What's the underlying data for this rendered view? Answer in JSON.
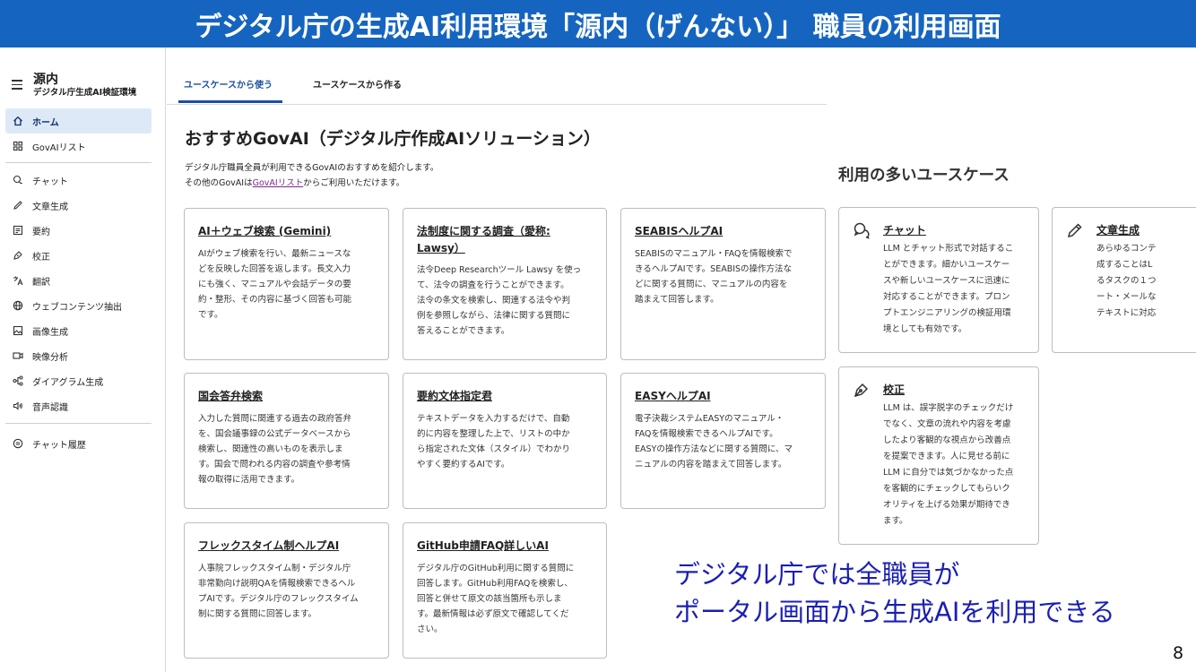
{
  "banner": {
    "title": "デジタル庁の生成AI利用環境「源内（げんない）」 職員の利用画面"
  },
  "sidebar": {
    "brand": "源内",
    "brand_sub": "デジタル庁生成AI検証環境",
    "items": [
      {
        "label": "ホーム",
        "icon": "home-icon"
      },
      {
        "label": "GovAIリスト",
        "icon": "grid-icon"
      },
      {
        "label": "チャット",
        "icon": "chat-icon"
      },
      {
        "label": "文章生成",
        "icon": "pencil-icon"
      },
      {
        "label": "要約",
        "icon": "summary-icon"
      },
      {
        "label": "校正",
        "icon": "pen-icon"
      },
      {
        "label": "翻訳",
        "icon": "translate-icon"
      },
      {
        "label": "ウェブコンテンツ抽出",
        "icon": "globe-icon"
      },
      {
        "label": "画像生成",
        "icon": "image-icon"
      },
      {
        "label": "映像分析",
        "icon": "video-icon"
      },
      {
        "label": "ダイアグラム生成",
        "icon": "diagram-icon"
      },
      {
        "label": "音声認識",
        "icon": "speaker-icon"
      },
      {
        "label": "チャット履歴",
        "icon": "history-icon"
      }
    ]
  },
  "tabs": [
    "ユースケースから使う",
    "ユースケースから作る"
  ],
  "main": {
    "heading": "おすすめGovAI（デジタル庁作成AIソリューション）",
    "intro_line1": "デジタル庁職員全員が利用できるGovAIのおすすめを紹介します。",
    "intro_line2_pre": "その他のGovAIは",
    "intro_link": "GovAIリスト",
    "intro_line2_post": "からご利用いただけます。"
  },
  "cards": [
    {
      "title": "AI＋ウェブ検索 (Gemini)",
      "lines": [
        "AIがウェブ検索を行い、最新ニュースな",
        "どを反映した回答を返します。長文入力",
        "にも強く、マニュアルや会話データの要",
        "約・整形、その内容に基づく回答も可能",
        "です。"
      ]
    },
    {
      "title": "法制度に関する調査（愛称:",
      "title2": "Lawsy）",
      "lines": [
        "法令Deep Researchツール Lawsy を使っ",
        "て、法令の調査を行うことができます。",
        "法令の条文を検索し、関連する法令や判",
        "例を参照しながら、法律に関する質問に",
        "答えることができます。"
      ]
    },
    {
      "title": "SEABISヘルプAI",
      "lines": [
        "SEABISのマニュアル・FAQを情報検索で",
        "きるヘルプAIです。SEABISの操作方法な",
        "どに関する質問に、マニュアルの内容を",
        "踏まえて回答します。"
      ]
    },
    {
      "title": "国会答弁検索",
      "lines": [
        "入力した質問に関連する過去の政府答弁",
        "を、国会議事録の公式データベースから",
        "検索し、関連性の高いものを表示しま",
        "す。国会で問われる内容の調査や参考情",
        "報の取得に活用できます。"
      ]
    },
    {
      "title": "要約文体指定君",
      "lines": [
        "テキストデータを入力するだけで、自動",
        "的に内容を整理した上で、リストの中か",
        "ら指定された文体（スタイル）でわかり",
        "やすく要約するAIです。"
      ]
    },
    {
      "title": "EASYヘルプAI",
      "lines": [
        "電子決裁システムEASYのマニュアル・",
        "FAQを情報検索できるヘルプAIです。",
        "EASYの操作方法などに関する質問に、マ",
        "ニュアルの内容を踏まえて回答します。"
      ]
    },
    {
      "title": "フレックスタイム制ヘルプAI",
      "lines": [
        "人事院フレックスタイム制・デジタル庁",
        "非常勤向け説明QAを情報検索できるヘル",
        "プAIです。デジタル庁のフレックスタイム",
        "制に関する質問に回答します。"
      ]
    },
    {
      "title": "GitHub申請FAQ詳しいAI",
      "lines": [
        "デジタル庁のGitHub利用に関する質問に",
        "回答します。GitHub利用FAQを検索し、",
        "回答と併せて原文の該当箇所も示しま",
        "す。最新情報は必ず原文で確認してくだ",
        "さい。"
      ]
    }
  ],
  "usecases": {
    "heading": "利用の多いユースケース",
    "items": [
      {
        "title": "チャット",
        "icon": "chat-icon",
        "lines": [
          "LLM とチャット形式で対話するこ",
          "とができます。細かいユースケー",
          "スや新しいユースケースに迅速に",
          "対応することができます。プロン",
          "プトエンジニアリングの検証用環",
          "境としても有効です。"
        ]
      },
      {
        "title": "文章生成",
        "icon": "pencil-icon",
        "lines": [
          "あらゆるコンテ",
          "成することはL",
          "るタスクの１つ",
          "ート・メールな",
          "テキストに対応"
        ]
      },
      {
        "title": "校正",
        "icon": "pen-icon",
        "lines": [
          "LLM は、誤字脱字のチェックだけ",
          "でなく、文章の流れや内容を考慮",
          "したより客観的な視点から改善点",
          "を提案できます。人に見せる前に",
          "LLM に自分では気づかなかった点",
          "を客観的にチェックしてもらいク",
          "オリティを上げる効果が期待でき",
          "ます。"
        ]
      }
    ]
  },
  "caption": {
    "line1": "デジタル庁では全職員が",
    "line2": "ポータル画面から生成AIを利用できる"
  },
  "page_number": "8"
}
